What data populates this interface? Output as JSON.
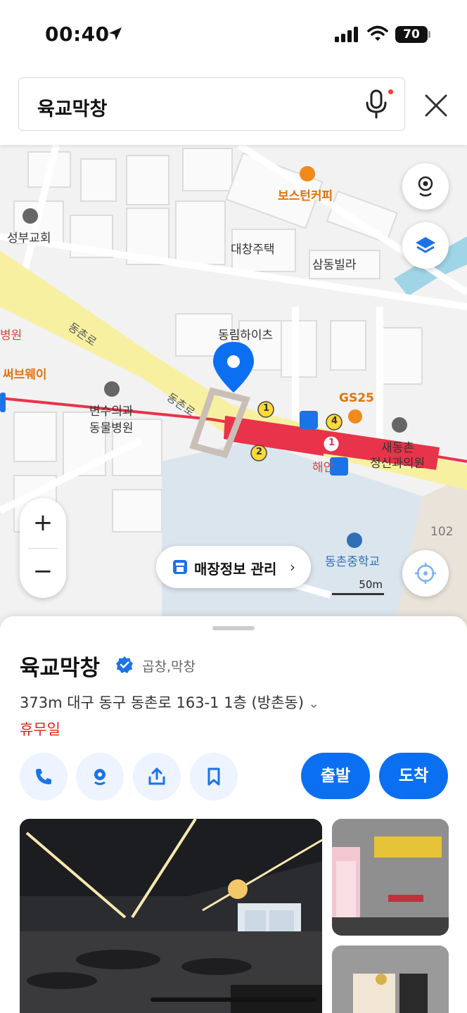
{
  "status_bar": {
    "time": "00:40",
    "battery": "70"
  },
  "search": {
    "query": "육교막창"
  },
  "map": {
    "labels": {
      "boston_coffee": "보스턴커피",
      "seongbu_church": "성부교회",
      "daechang_house": "대창주택",
      "samdong_villa": "삼동빌라",
      "dongchon_ro_1": "동촌로",
      "dongchon_ro_2": "동촌로",
      "dongrim_heights": "동림하이츠",
      "subway": "써브웨이",
      "hospital_fragment": "병원",
      "vet_line1": "변수의과",
      "vet_line2": "동물병원",
      "gs25": "GS25",
      "clinic_line1": "새동촌",
      "clinic_line2": "정신과의원",
      "haean_fragment": "해안",
      "middle_school": "동촌중학교",
      "building_102": "102",
      "exit_1": "1",
      "exit_2": "2",
      "exit_4": "4",
      "exit_1b": "1"
    },
    "store_manage": "매장정보 관리",
    "scale": "50m",
    "zoom_in": "+",
    "zoom_out": "−"
  },
  "place": {
    "name": "육교막창",
    "category": "곱창,막창",
    "distance": "373m",
    "address": "대구 동구 동촌로 163-1 1층 (방촌동)",
    "status": "휴무일",
    "depart_label": "출발",
    "arrive_label": "도착"
  },
  "icons": [
    "location-arrow-icon",
    "signal-icon",
    "wifi-icon",
    "battery-icon",
    "mic-icon",
    "close-icon",
    "street-view-icon",
    "layers-icon",
    "current-location-icon",
    "store-icon",
    "verified-icon",
    "phone-icon",
    "pin-icon",
    "share-icon",
    "bookmark-icon",
    "chevron-down-icon",
    "chevron-right-icon"
  ],
  "colors": {
    "accent": "#0b6ff2",
    "holiday": "#e0241c",
    "subway_line": "#e8334a",
    "road": "#f7f0a0"
  }
}
